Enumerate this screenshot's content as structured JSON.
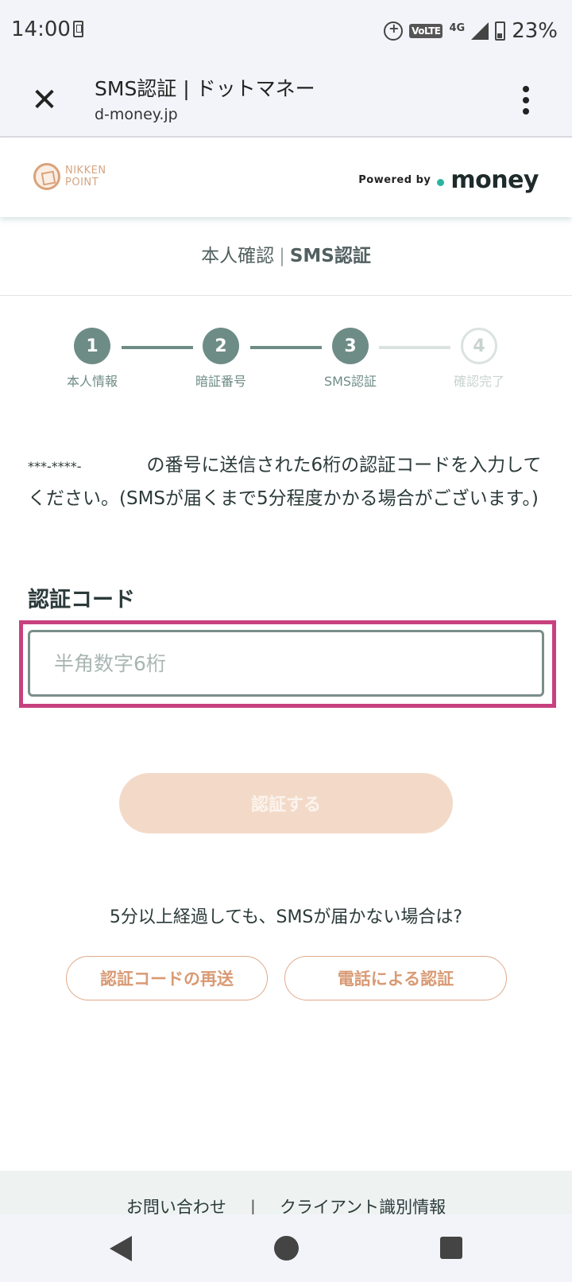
{
  "status_bar": {
    "time": "14:00",
    "network_label": "4G",
    "volte_label": "VoLTE",
    "battery_percent": "23%"
  },
  "browser": {
    "title": "SMS認証 | ドットマネー",
    "url": "d-money.jp"
  },
  "header": {
    "brand_logo_text": "NIKKEN POINT",
    "powered_by_label": "Powered by",
    "money_logo_text": "money"
  },
  "section": {
    "title_prefix": "本人確認",
    "title_separator": "|",
    "title_main": "SMS認証"
  },
  "steps": [
    {
      "number": "1",
      "label": "本人情報",
      "state": "done"
    },
    {
      "number": "2",
      "label": "暗証番号",
      "state": "done"
    },
    {
      "number": "3",
      "label": "SMS認証",
      "state": "done"
    },
    {
      "number": "4",
      "label": "確認完了",
      "state": "todo"
    }
  ],
  "instruction": {
    "masked_number": "***-****-",
    "text": "の番号に送信された6桁の認証コードを入力してください。(SMSが届くまで5分程度かかる場合がございます。)"
  },
  "form": {
    "code_label": "認証コード",
    "code_placeholder": "半角数字6桁",
    "code_value": "",
    "submit_label": "認証する"
  },
  "help": {
    "text": "5分以上経過しても、SMSが届かない場合は?",
    "resend_label": "認証コードの再送",
    "phone_label": "電話による認証"
  },
  "footer": {
    "contact_label": "お問い合わせ",
    "separator": "|",
    "client_info_label": "クライアント識別情報"
  },
  "colors": {
    "step_active": "#6e8c86",
    "step_inactive": "#dbe3e1",
    "focus_frame": "#c7417e",
    "submit_disabled_bg": "#f3dac8",
    "accent_orange": "#d99a74",
    "money_dot": "#2bb3a3"
  },
  "icons": {
    "close": "close-icon",
    "menu": "more-vert-icon",
    "back": "nav-back-icon",
    "home": "nav-home-icon",
    "recent": "nav-recent-icon"
  }
}
